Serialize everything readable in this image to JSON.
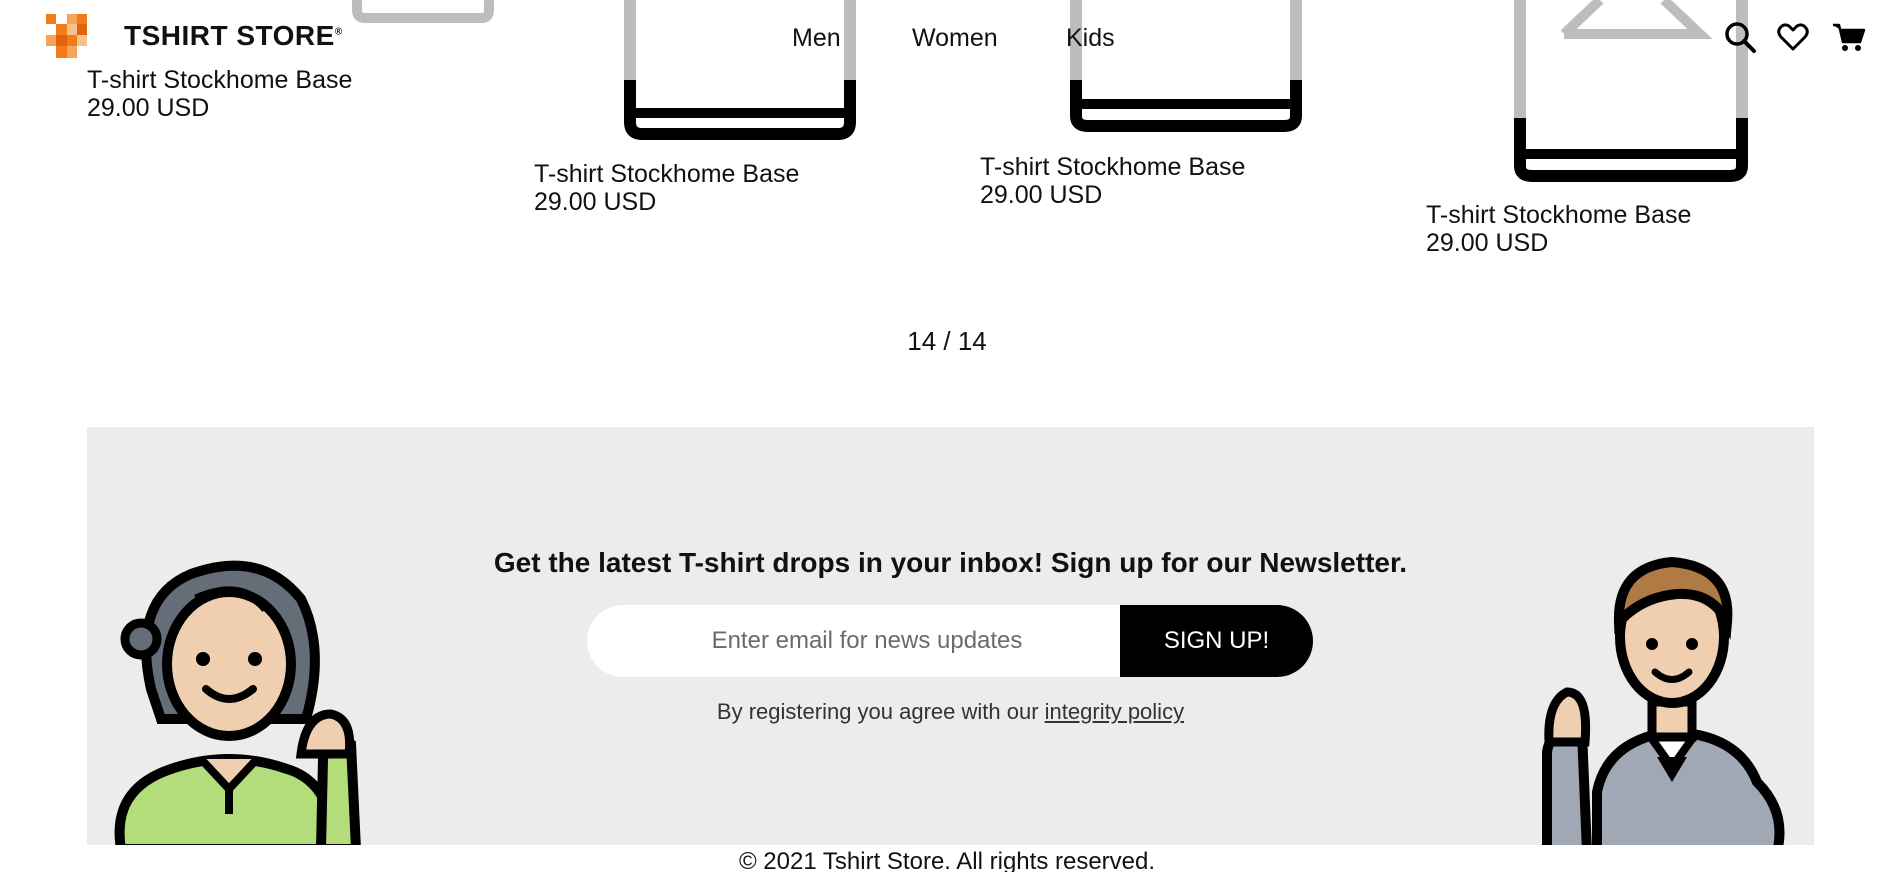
{
  "header": {
    "brand": "TSHIRT STORE",
    "brand_mark": "®",
    "nav": [
      "Men",
      "Women",
      "Kids"
    ],
    "icons": [
      "search-icon",
      "heart-icon",
      "cart-icon"
    ]
  },
  "products": [
    {
      "name": "T-shirt Stockhome Base",
      "price": "29.00 USD"
    },
    {
      "name": "T-shirt Stockhome Base",
      "price": "29.00 USD"
    },
    {
      "name": "T-shirt Stockhome Base",
      "price": "29.00 USD"
    },
    {
      "name": "T-shirt Stockhome Base",
      "price": "29.00 USD"
    }
  ],
  "pagination": "14 / 14",
  "newsletter": {
    "title": "Get the latest T-shirt drops in your inbox! Sign up for our Newsletter.",
    "placeholder": "Enter email for news updates",
    "button": "SIGN UP!",
    "terms_prefix": "By registering you agree with our",
    "terms_link": "integrity policy"
  },
  "footer": {
    "copyright": "© 2021 Tshirt Store. All rights reserved."
  },
  "colors": {
    "accent_orange": "#f07d1a",
    "newsletter_bg": "#ececec",
    "button_bg": "#000000"
  }
}
